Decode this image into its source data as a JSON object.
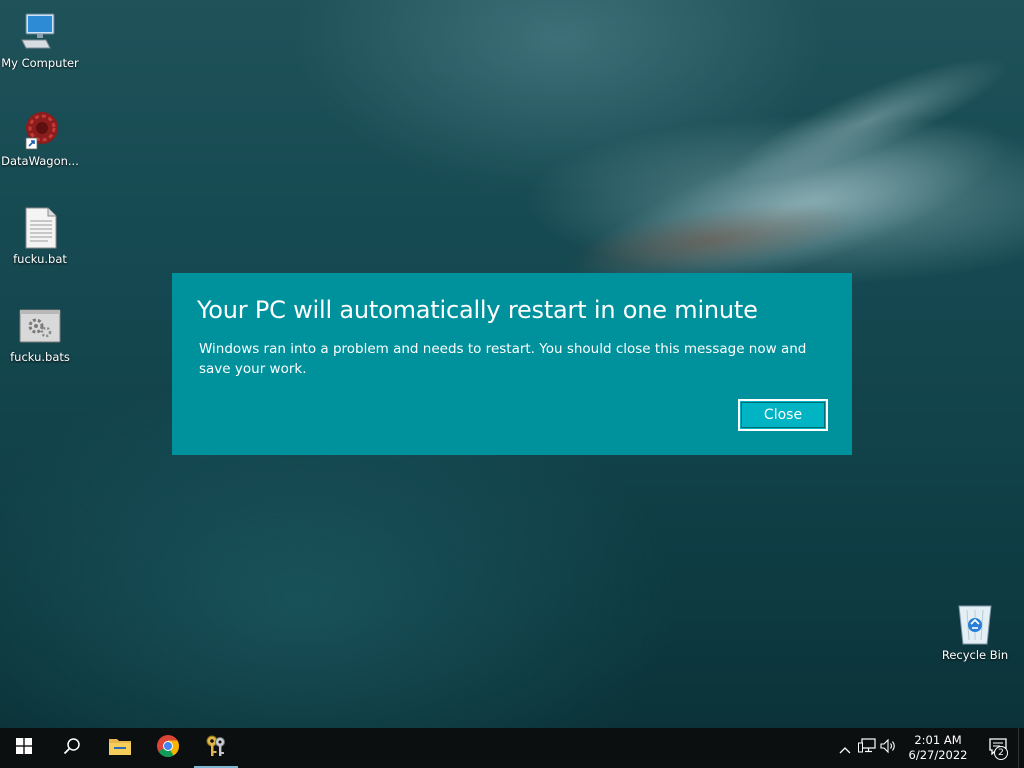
{
  "desktop": {
    "icons": [
      {
        "label": "My Computer",
        "icon": "computer-icon"
      },
      {
        "label": "DataWagon...",
        "icon": "datawagon-shortcut-icon"
      },
      {
        "label": "fucku.bat",
        "icon": "text-file-icon"
      },
      {
        "label": "fucku.bats",
        "icon": "settings-file-icon"
      },
      {
        "label": "Recycle Bin",
        "icon": "recycle-bin-icon"
      }
    ]
  },
  "dialog": {
    "title": "Your PC will automatically restart in one minute",
    "message": "Windows ran into a problem and needs to restart. You should close this message now and save your work.",
    "close_label": "Close",
    "background_color": "#00929c",
    "button_color": "#00b4c3"
  },
  "taskbar": {
    "apps": [
      {
        "name": "start",
        "icon": "windows-logo-icon"
      },
      {
        "name": "search",
        "icon": "search-icon"
      },
      {
        "name": "file-explorer",
        "icon": "folder-icon"
      },
      {
        "name": "chrome",
        "icon": "chrome-icon"
      },
      {
        "name": "keys-app",
        "icon": "keys-icon",
        "active": true
      }
    ],
    "tray": {
      "icons": [
        "chevron-up-icon",
        "network-icon",
        "volume-icon"
      ],
      "time": "2:01 AM",
      "date": "6/27/2022",
      "notification_count": "2"
    }
  }
}
